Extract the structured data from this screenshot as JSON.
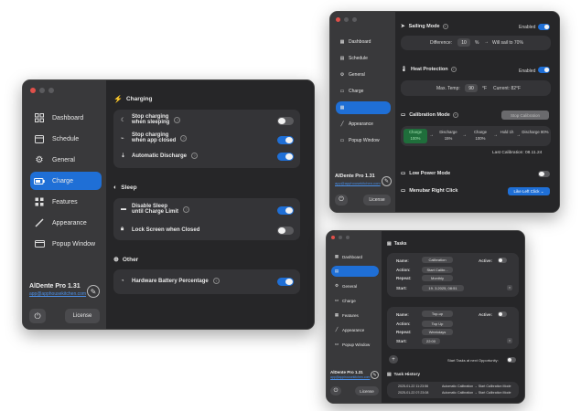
{
  "window_main": {
    "nav": [
      {
        "label": "Dashboard",
        "icon": "dashboard-icon"
      },
      {
        "label": "Schedule",
        "icon": "calendar-icon"
      },
      {
        "label": "General",
        "icon": "gear-icon"
      },
      {
        "label": "Charge",
        "icon": "battery-icon",
        "selected": true
      },
      {
        "label": "Features",
        "icon": "grid-icon"
      },
      {
        "label": "Appearance",
        "icon": "brush-icon"
      },
      {
        "label": "Popup Window",
        "icon": "popup-icon"
      }
    ],
    "app_name": "AlDente Pro 1.31",
    "app_email": "app@apphousekitchen.com",
    "license_label": "License",
    "sections": {
      "charging": {
        "title": "Charging",
        "rows": [
          {
            "label": "Stop charging",
            "label2": "when sleeping",
            "on": false
          },
          {
            "label": "Stop charging",
            "label2": "when app closed",
            "on": true
          },
          {
            "label": "Automatic Discharge",
            "on": true
          }
        ]
      },
      "sleep": {
        "title": "Sleep",
        "rows": [
          {
            "label": "Disable Sleep",
            "label2": "until Charge Limit",
            "on": true
          },
          {
            "label": "Lock Screen when Closed",
            "on": false
          }
        ]
      },
      "other": {
        "title": "Other",
        "rows": [
          {
            "label": "Hardware Battery Percentage",
            "on": true
          }
        ]
      }
    }
  },
  "window_tr": {
    "nav": [
      "Dashboard",
      "Schedule",
      "General",
      "Charge",
      "",
      "Appearance",
      "Popup Window"
    ],
    "app_name": "AlDente Pro 1.31",
    "app_email": "app@apphousekitchen.com",
    "license_label": "License",
    "sailing": {
      "title": "Sailing Mode",
      "status": "Enabled",
      "difference_label": "Difference:",
      "difference_value": "10",
      "unit": "%",
      "result": "Will sail to 70%"
    },
    "heat": {
      "title": "Heat Protection",
      "status": "Enabled",
      "max_label": "Max. Temp:",
      "max_value": "90",
      "unit": "°F",
      "current": "Current: 82°F"
    },
    "calibration": {
      "title": "Calibration Mode",
      "button": "Stop Calibration",
      "steps": [
        "Charge 100%",
        "Discharge 15%",
        "Charge 100%",
        "Hold 1h",
        "Discharge 80%"
      ],
      "last": "Last Calibration: 08.11.24"
    },
    "low_power": "Low Power Mode",
    "menubar": {
      "label": "Menubar Right Click",
      "value": "Like Left Click"
    }
  },
  "window_br": {
    "nav": [
      "Dashboard",
      "",
      "General",
      "Charge",
      "Features",
      "Appearance",
      "Popup Window"
    ],
    "app_name": "AlDente Pro 1.31",
    "app_email": "app@apphousekitchen.com",
    "license_label": "License",
    "tasks_title": "Tasks",
    "task1": {
      "name_label": "Name:",
      "name": "Calibration",
      "active_label": "Active:",
      "action_label": "Action:",
      "action": "Start Calibr...",
      "repeat_label": "Repeat:",
      "repeat": "Monthly",
      "start_label": "Start:",
      "start": "19. 3.2025, 08:51"
    },
    "task2": {
      "name_label": "Name:",
      "name": "Top-up",
      "active_label": "Active:",
      "action_label": "Action:",
      "action": "Top Up",
      "repeat_label": "Repeat:",
      "repeat": "Weekdays",
      "start_label": "Start:",
      "start": "22:00"
    },
    "opportunity": "Start Tasks at next Opportunity:",
    "history_title": "Task History",
    "history": [
      {
        "date": "2025-01-22 11:23:56",
        "text": "Automatic Calibration → Start Calibration Mode"
      },
      {
        "date": "2025-01-22 07:23:08",
        "text": "Automatic Calibration → Start Calibration Mode"
      }
    ]
  }
}
